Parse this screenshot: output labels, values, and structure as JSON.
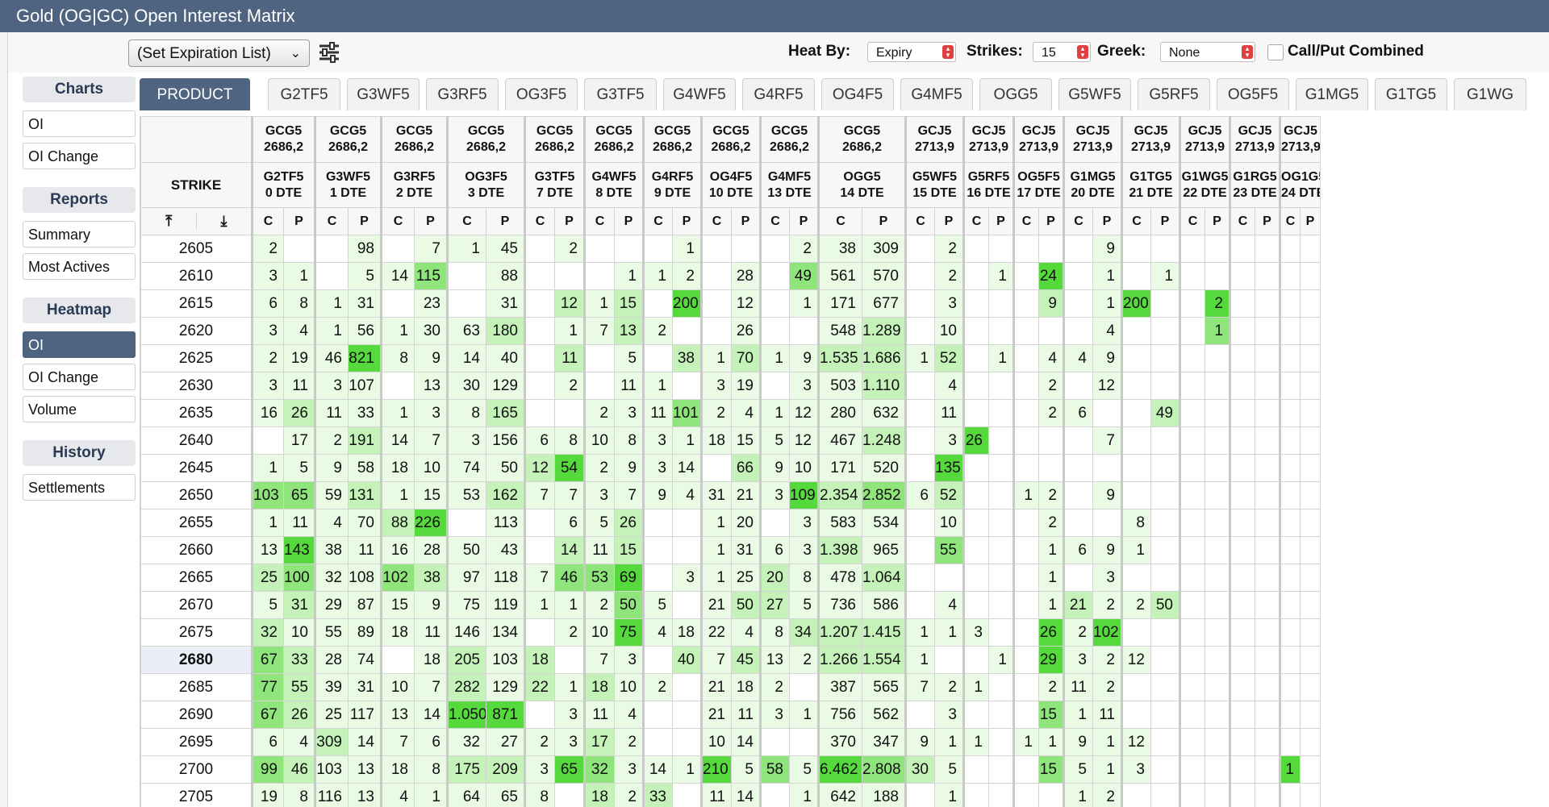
{
  "window": {
    "title": "Gold (OG|GC) Open Interest Matrix"
  },
  "toolbar": {
    "expiration_select": "(Set Expiration List)",
    "heat_by_label": "Heat By:",
    "heat_by_value": "Expiry",
    "strikes_label": "Strikes:",
    "strikes_value": "15",
    "greek_label": "Greek:",
    "greek_value": "None",
    "call_put_label": "Call/Put Combined",
    "call_put_checked": false
  },
  "nav": {
    "charts": {
      "title": "Charts",
      "items": [
        "OI",
        "OI Change"
      ]
    },
    "reports": {
      "title": "Reports",
      "items": [
        "Summary",
        "Most Actives"
      ]
    },
    "heatmap": {
      "title": "Heatmap",
      "items": [
        "OI",
        "OI Change",
        "Volume"
      ],
      "active": "OI"
    },
    "history": {
      "title": "History",
      "items": [
        "Settlements"
      ]
    }
  },
  "tabs": [
    "PRODUCT (OG)",
    "G2TF5",
    "G3WF5",
    "G3RF5",
    "OG3F5",
    "G3TF5",
    "G4WF5",
    "G4RF5",
    "OG4F5",
    "G4MF5",
    "OGG5",
    "G5WF5",
    "G5RF5",
    "OG5F5",
    "G1MG5",
    "G1TG5",
    "G1WG"
  ],
  "active_tab": "PRODUCT (OG)",
  "matrix": {
    "strike_header": "STRIKE",
    "call_label": "C",
    "put_label": "P",
    "atm_strike": "2680",
    "columns": [
      {
        "underlying": "GCG5",
        "price": "2686,2",
        "option": "G2TF5",
        "dte": "0 DTE"
      },
      {
        "underlying": "GCG5",
        "price": "2686,2",
        "option": "G3WF5",
        "dte": "1 DTE"
      },
      {
        "underlying": "GCG5",
        "price": "2686,2",
        "option": "G3RF5",
        "dte": "2 DTE"
      },
      {
        "underlying": "GCG5",
        "price": "2686,2",
        "option": "OG3F5",
        "dte": "3 DTE"
      },
      {
        "underlying": "GCG5",
        "price": "2686,2",
        "option": "G3TF5",
        "dte": "7 DTE"
      },
      {
        "underlying": "GCG5",
        "price": "2686,2",
        "option": "G4WF5",
        "dte": "8 DTE"
      },
      {
        "underlying": "GCG5",
        "price": "2686,2",
        "option": "G4RF5",
        "dte": "9 DTE"
      },
      {
        "underlying": "GCG5",
        "price": "2686,2",
        "option": "OG4F5",
        "dte": "10 DTE"
      },
      {
        "underlying": "GCG5",
        "price": "2686,2",
        "option": "G4MF5",
        "dte": "13 DTE"
      },
      {
        "underlying": "GCG5",
        "price": "2686,2",
        "option": "OGG5",
        "dte": "14 DTE"
      },
      {
        "underlying": "GCJ5",
        "price": "2713,9",
        "option": "G5WF5",
        "dte": "15 DTE"
      },
      {
        "underlying": "GCJ5",
        "price": "2713,9",
        "option": "G5RF5",
        "dte": "16 DTE"
      },
      {
        "underlying": "GCJ5",
        "price": "2713,9",
        "option": "OG5F5",
        "dte": "17 DTE"
      },
      {
        "underlying": "GCJ5",
        "price": "2713,9",
        "option": "G1MG5",
        "dte": "20 DTE"
      },
      {
        "underlying": "GCJ5",
        "price": "2713,9",
        "option": "G1TG5",
        "dte": "21 DTE"
      },
      {
        "underlying": "GCJ5",
        "price": "2713,9",
        "option": "G1WG5",
        "dte": "22 DTE"
      },
      {
        "underlying": "GCJ5",
        "price": "2713,9",
        "option": "G1RG5",
        "dte": "23 DTE"
      },
      {
        "underlying": "GCJ5",
        "price": "2713,9",
        "option": "OG1G5",
        "dte": "24 DTE"
      }
    ],
    "rows": [
      {
        "strike": "2605",
        "cells": [
          "2",
          "",
          "",
          "98",
          "",
          "7",
          "1",
          "45",
          "",
          "2",
          "",
          "",
          "",
          "1",
          "",
          "",
          "",
          "2",
          "38",
          "309",
          "",
          "2",
          "",
          "",
          "",
          "",
          "",
          "9",
          "",
          "",
          "",
          "",
          "",
          "",
          "",
          ""
        ]
      },
      {
        "strike": "2610",
        "cells": [
          "3",
          "1",
          "",
          "5",
          "14",
          "115",
          "",
          "88",
          "",
          "",
          "",
          "1",
          "1",
          "2",
          "",
          "28",
          "",
          "49",
          "561",
          "570",
          "",
          "2",
          "",
          "1",
          "",
          "24",
          "",
          "1",
          "",
          "1",
          "",
          "",
          "",
          "",
          "",
          ""
        ]
      },
      {
        "strike": "2615",
        "cells": [
          "6",
          "8",
          "1",
          "31",
          "",
          "23",
          "",
          "31",
          "",
          "12",
          "1",
          "15",
          "",
          "200",
          "",
          "12",
          "",
          "1",
          "171",
          "677",
          "",
          "3",
          "",
          "",
          "",
          "9",
          "",
          "1",
          "200",
          "",
          "",
          "2",
          "",
          "",
          "",
          ""
        ]
      },
      {
        "strike": "2620",
        "cells": [
          "3",
          "4",
          "1",
          "56",
          "1",
          "30",
          "63",
          "180",
          "",
          "1",
          "7",
          "13",
          "2",
          "",
          "",
          "26",
          "",
          "",
          "548",
          "1.289",
          "",
          "10",
          "",
          "",
          "",
          "",
          "",
          "4",
          "",
          "",
          "",
          "1",
          "",
          "",
          "",
          ""
        ]
      },
      {
        "strike": "2625",
        "cells": [
          "2",
          "19",
          "46",
          "821",
          "8",
          "9",
          "14",
          "40",
          "",
          "11",
          "",
          "5",
          "",
          "38",
          "1",
          "70",
          "1",
          "9",
          "1.535",
          "1.686",
          "1",
          "52",
          "",
          "1",
          "",
          "4",
          "4",
          "9",
          "",
          "",
          "",
          "",
          "",
          "",
          "",
          ""
        ]
      },
      {
        "strike": "2630",
        "cells": [
          "3",
          "11",
          "3",
          "107",
          "",
          "13",
          "30",
          "129",
          "",
          "2",
          "",
          "11",
          "1",
          "",
          "3",
          "19",
          "",
          "3",
          "503",
          "1.110",
          "",
          "4",
          "",
          "",
          "",
          "2",
          "",
          "12",
          "",
          "",
          "",
          "",
          "",
          "",
          "",
          ""
        ]
      },
      {
        "strike": "2635",
        "cells": [
          "16",
          "26",
          "11",
          "33",
          "1",
          "3",
          "8",
          "165",
          "",
          "",
          "2",
          "3",
          "11",
          "101",
          "2",
          "4",
          "1",
          "12",
          "280",
          "632",
          "",
          "11",
          "",
          "",
          "",
          "2",
          "6",
          "",
          "",
          "49",
          "",
          "",
          "",
          "",
          "",
          ""
        ]
      },
      {
        "strike": "2640",
        "cells": [
          "",
          "17",
          "2",
          "191",
          "14",
          "7",
          "3",
          "156",
          "6",
          "8",
          "10",
          "8",
          "3",
          "1",
          "18",
          "15",
          "5",
          "12",
          "467",
          "1.248",
          "",
          "3",
          "26",
          "",
          "",
          "",
          "",
          "7",
          "",
          "",
          "",
          "",
          "",
          "",
          "",
          ""
        ]
      },
      {
        "strike": "2645",
        "cells": [
          "1",
          "5",
          "9",
          "58",
          "18",
          "10",
          "74",
          "50",
          "12",
          "54",
          "2",
          "9",
          "3",
          "14",
          "",
          "66",
          "9",
          "10",
          "171",
          "520",
          "",
          "135",
          "",
          "",
          "",
          "",
          "",
          "",
          "",
          "",
          "",
          "",
          "",
          "",
          "",
          ""
        ]
      },
      {
        "strike": "2650",
        "cells": [
          "103",
          "65",
          "59",
          "131",
          "1",
          "15",
          "53",
          "162",
          "7",
          "7",
          "3",
          "7",
          "9",
          "4",
          "31",
          "21",
          "3",
          "109",
          "2.354",
          "2.852",
          "6",
          "52",
          "",
          "",
          "1",
          "2",
          "",
          "9",
          "",
          "",
          "",
          "",
          "",
          "",
          "",
          ""
        ]
      },
      {
        "strike": "2655",
        "cells": [
          "1",
          "11",
          "4",
          "70",
          "88",
          "226",
          "",
          "113",
          "",
          "6",
          "5",
          "26",
          "",
          "",
          "1",
          "20",
          "",
          "3",
          "583",
          "534",
          "",
          "10",
          "",
          "",
          "",
          "2",
          "",
          "",
          "8",
          "",
          "",
          "",
          "",
          "",
          "",
          ""
        ]
      },
      {
        "strike": "2660",
        "cells": [
          "13",
          "143",
          "38",
          "11",
          "16",
          "28",
          "50",
          "43",
          "",
          "14",
          "11",
          "15",
          "",
          "",
          "1",
          "31",
          "6",
          "3",
          "1.398",
          "965",
          "",
          "55",
          "",
          "",
          "",
          "1",
          "6",
          "9",
          "1",
          "",
          "",
          "",
          "",
          "",
          "",
          ""
        ]
      },
      {
        "strike": "2665",
        "cells": [
          "25",
          "100",
          "32",
          "108",
          "102",
          "38",
          "97",
          "118",
          "7",
          "46",
          "53",
          "69",
          "",
          "3",
          "1",
          "25",
          "20",
          "8",
          "478",
          "1.064",
          "",
          "",
          "",
          "",
          "",
          "1",
          "",
          "3",
          "",
          "",
          "",
          "",
          "",
          "",
          "",
          ""
        ]
      },
      {
        "strike": "2670",
        "cells": [
          "5",
          "31",
          "29",
          "87",
          "15",
          "9",
          "75",
          "119",
          "1",
          "1",
          "2",
          "50",
          "5",
          "",
          "21",
          "50",
          "27",
          "5",
          "736",
          "586",
          "",
          "4",
          "",
          "",
          "",
          "1",
          "21",
          "2",
          "2",
          "50",
          "",
          "",
          "",
          "",
          "",
          ""
        ]
      },
      {
        "strike": "2675",
        "cells": [
          "32",
          "10",
          "55",
          "89",
          "18",
          "11",
          "146",
          "134",
          "",
          "2",
          "10",
          "75",
          "4",
          "18",
          "22",
          "4",
          "8",
          "34",
          "1.207",
          "1.415",
          "1",
          "1",
          "3",
          "",
          "",
          "26",
          "2",
          "102",
          "",
          "",
          "",
          "",
          "",
          "",
          "",
          ""
        ]
      },
      {
        "strike": "2680",
        "cells": [
          "67",
          "33",
          "28",
          "74",
          "",
          "18",
          "205",
          "103",
          "18",
          "",
          "7",
          "3",
          "",
          "40",
          "7",
          "45",
          "13",
          "2",
          "1.266",
          "1.554",
          "1",
          "",
          "",
          "1",
          "",
          "29",
          "3",
          "2",
          "12",
          "",
          "",
          "",
          "",
          "",
          "",
          ""
        ]
      },
      {
        "strike": "2685",
        "cells": [
          "77",
          "55",
          "39",
          "31",
          "10",
          "7",
          "282",
          "129",
          "22",
          "1",
          "18",
          "10",
          "2",
          "",
          "21",
          "18",
          "2",
          "",
          "387",
          "565",
          "7",
          "2",
          "1",
          "",
          "",
          "2",
          "11",
          "2",
          "",
          "",
          "",
          "",
          "",
          "",
          "",
          ""
        ]
      },
      {
        "strike": "2690",
        "cells": [
          "67",
          "26",
          "25",
          "117",
          "13",
          "14",
          "1.050",
          "871",
          "",
          "3",
          "11",
          "4",
          "",
          "",
          "21",
          "11",
          "3",
          "1",
          "756",
          "562",
          "",
          "3",
          "",
          "",
          "",
          "15",
          "1",
          "11",
          "",
          "",
          "",
          "",
          "",
          "",
          "",
          ""
        ]
      },
      {
        "strike": "2695",
        "cells": [
          "6",
          "4",
          "309",
          "14",
          "7",
          "6",
          "32",
          "27",
          "2",
          "3",
          "17",
          "2",
          "",
          "",
          "10",
          "14",
          "",
          "",
          "370",
          "347",
          "9",
          "1",
          "1",
          "",
          "1",
          "1",
          "9",
          "1",
          "12",
          "",
          "",
          "",
          "",
          "",
          "",
          ""
        ]
      },
      {
        "strike": "2700",
        "cells": [
          "99",
          "46",
          "103",
          "13",
          "18",
          "8",
          "175",
          "209",
          "3",
          "65",
          "32",
          "3",
          "14",
          "1",
          "210",
          "5",
          "58",
          "5",
          "6.462",
          "2.808",
          "30",
          "5",
          "",
          "",
          "",
          "15",
          "5",
          "1",
          "3",
          "",
          "",
          "",
          "",
          "",
          "1",
          ""
        ]
      },
      {
        "strike": "2705",
        "cells": [
          "19",
          "8",
          "116",
          "13",
          "4",
          "1",
          "64",
          "65",
          "8",
          "",
          "18",
          "2",
          "33",
          "",
          "11",
          "14",
          "",
          "1",
          "642",
          "188",
          "",
          "1",
          "",
          "",
          "",
          "",
          "1",
          "2",
          "",
          "",
          "",
          "",
          "",
          "",
          "",
          ""
        ]
      }
    ]
  }
}
